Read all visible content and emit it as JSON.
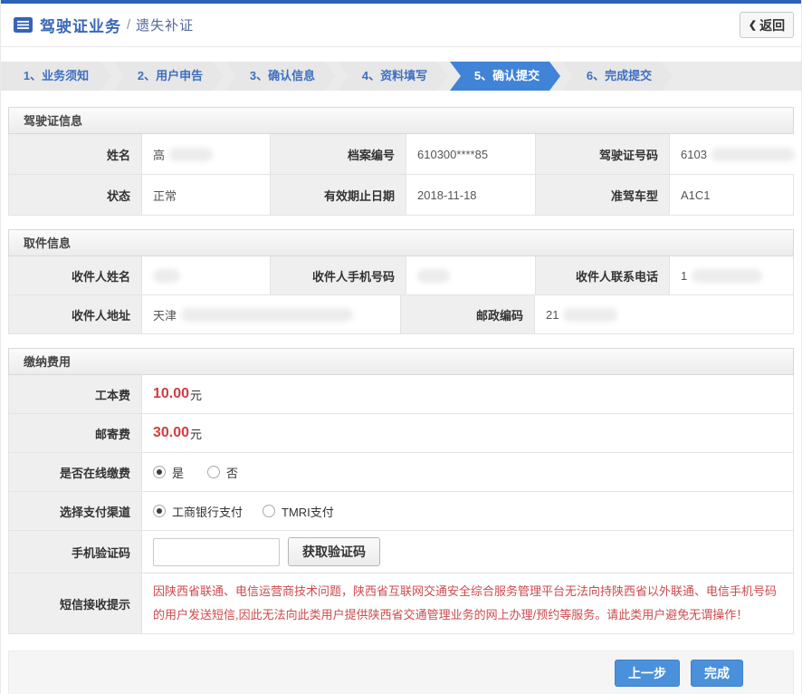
{
  "page": {
    "title": "驾驶证业务",
    "title_separator": "/",
    "subtitle": "遗失补证",
    "back_icon": "❮",
    "back_label": "返回"
  },
  "steps": {
    "items": [
      {
        "label": "1、业务须知",
        "active": false
      },
      {
        "label": "2、用户申告",
        "active": false
      },
      {
        "label": "3、确认信息",
        "active": false
      },
      {
        "label": "4、资料填写",
        "active": false
      },
      {
        "label": "5、确认提交",
        "active": true
      },
      {
        "label": "6、完成提交",
        "active": false
      }
    ]
  },
  "license_section": {
    "title": "驾驶证信息",
    "name_label": "姓名",
    "name_value": "高",
    "file_no_label": "档案编号",
    "file_no_value": "610300****85",
    "license_no_label": "驾驶证号码",
    "license_no_value": "6103",
    "status_label": "状态",
    "status_value": "正常",
    "expiry_label": "有效期止日期",
    "expiry_value": "2018-11-18",
    "vehicle_label": "准驾车型",
    "vehicle_value": "A1C1"
  },
  "pickup_section": {
    "title": "取件信息",
    "recipient_name_label": "收件人姓名",
    "recipient_name_value": "",
    "recipient_mobile_label": "收件人手机号码",
    "recipient_mobile_value": "",
    "recipient_phone_label": "收件人联系电话",
    "recipient_phone_value": "1",
    "recipient_address_label": "收件人地址",
    "recipient_address_value": "天津",
    "postal_code_label": "邮政编码",
    "postal_code_value": "21"
  },
  "payment_section": {
    "title": "缴纳费用",
    "production_fee_label": "工本费",
    "production_fee_value": "10.00",
    "mailing_fee_label": "邮寄费",
    "mailing_fee_value": "30.00",
    "fee_unit": "元",
    "online_payment_label": "是否在线缴费",
    "online_payment_options": [
      {
        "label": "是",
        "checked": true
      },
      {
        "label": "否",
        "checked": false
      }
    ],
    "channel_label": "选择支付渠道",
    "channel_options": [
      {
        "label": "工商银行支付",
        "checked": true
      },
      {
        "label": "TMRI支付",
        "checked": false
      }
    ],
    "sms_code_label": "手机验证码",
    "sms_code_value": "",
    "get_code_button": "获取验证码",
    "notice_label": "短信接收提示",
    "notice_text": "因陕西省联通、电信运营商技术问题，陕西省互联网交通安全综合服务管理平台无法向持陕西省以外联通、电信手机号码的用户发送短信,因此无法向此类用户提供陕西省交通管理业务的网上办理/预约等服务。请此类用户避免无谓操作！"
  },
  "footer": {
    "prev_button": "上一步",
    "done_button": "完成"
  },
  "colors": {
    "top_bar_blue": "#2c63b5",
    "accent_blue": "#3a67b8",
    "active_step_blue": "#4183d7",
    "button_blue": "#4a90da",
    "fee_red": "#d23c3e",
    "notice_red": "#cd4a4c"
  }
}
